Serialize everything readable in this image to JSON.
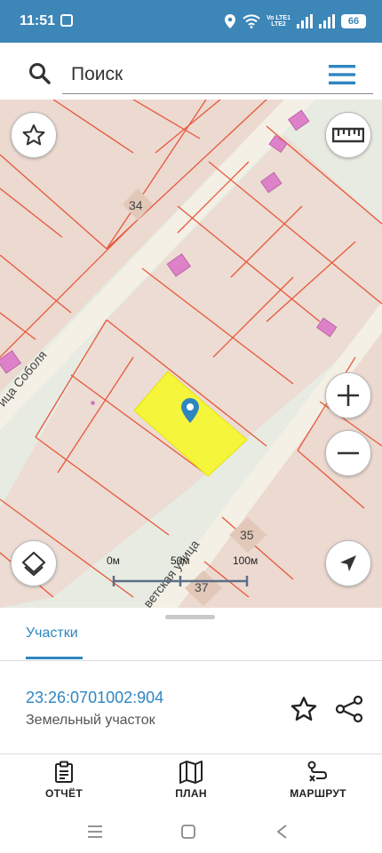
{
  "status_bar": {
    "time": "11:51",
    "network_top": "Vo LTE1",
    "network_bottom": "LTE2",
    "battery": "66"
  },
  "search": {
    "placeholder": "Поиск"
  },
  "map": {
    "street_labels": [
      "ица Соболя",
      "ветская улица"
    ],
    "house_numbers": [
      "34",
      "35",
      "37"
    ],
    "scale": {
      "labels": [
        "0м",
        "50м",
        "100м"
      ]
    },
    "colors": {
      "background": "#e7ebe1",
      "parcel_fill": "#ecd9d0",
      "parcel_border": "#e8573a",
      "building": "#dd82c9",
      "road": "#f4f0e6",
      "selected": "#f5f53c"
    }
  },
  "sheet": {
    "tab": "Участки",
    "parcel": {
      "cadastral_number": "23:26:0701002:904",
      "type": "Земельный участок"
    }
  },
  "bottom_nav": [
    {
      "label": "ОТЧЁТ",
      "icon": "report-icon"
    },
    {
      "label": "ПЛАН",
      "icon": "map-plan-icon"
    },
    {
      "label": "МАРШРУТ",
      "icon": "route-icon"
    }
  ],
  "system_nav": [
    "recent-apps-icon",
    "home-icon",
    "back-icon"
  ]
}
